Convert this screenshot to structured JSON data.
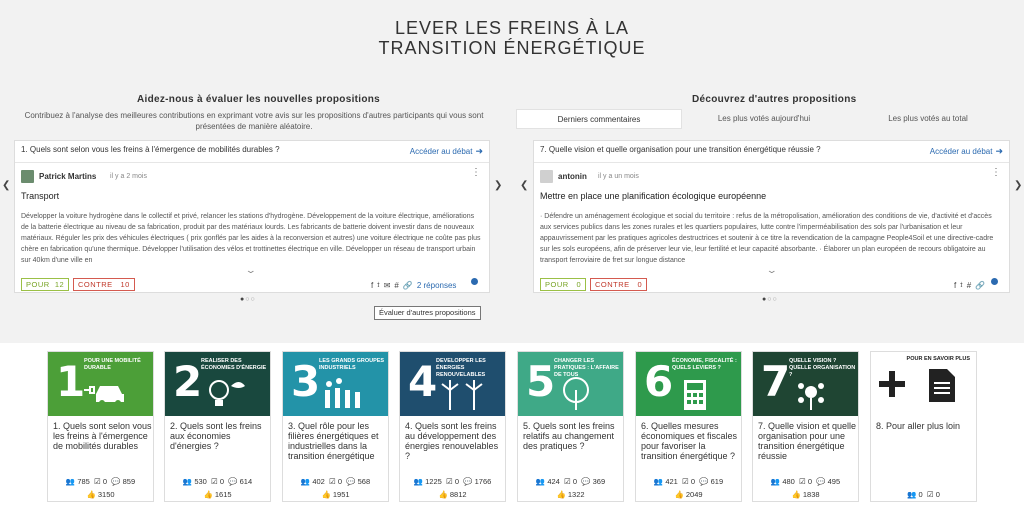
{
  "page": {
    "title_line1": "LEVER LES FREINS À LA",
    "title_line2": "TRANSITION ÉNERGÉTIQUE"
  },
  "colors": {
    "accent_blue": "#2b6ab0",
    "pour_green": "#77a324",
    "contre_red": "#c0392b"
  },
  "left_panel": {
    "heading": "Aidez-nous à évaluer les nouvelles propositions",
    "intro": "Contribuez à l'analyse des meilleures contributions en exprimant votre avis sur les propositions d'autres participants qui vous sont présentées de manière aléatoire.",
    "card": {
      "question": "1. Quels sont selon vous les freins à l'émergence de mobilités durables ?",
      "debate_link": "Accéder au débat",
      "author": "Patrick Martins",
      "time": "il y a 2 mois",
      "title": "Transport",
      "body": "Développer la voiture hydrogène dans le collectif et privé, relancer les stations d'hydrogène. Développement de la voiture électrique, améliorations de la batterie électrique au niveau de sa fabrication, produit par des matériaux lourds. Les fabricants de batterie doivent investir dans de nouveaux matériaux. Réguler les prix des véhicules électriques ( prix gonflés par les aides à la reconversion et autres) une voiture électrique ne coûte pas plus chère en fabrication qu'une thermique. Développer l'utilisation des vélos et trottinettes électrique en ville. Développer un réseau de transport urbain sur 40km d'une ville en",
      "pour_label": "POUR",
      "pour_count": "12",
      "contre_label": "CONTRE",
      "contre_count": "10",
      "replies": "2 réponses"
    },
    "eval_button": "Évaluer d'autres propositions"
  },
  "right_panel": {
    "heading": "Découvrez d'autres propositions",
    "tabs": [
      "Derniers commentaires",
      "Les plus votés aujourd'hui",
      "Les plus votés au total"
    ],
    "card": {
      "question": "7. Quelle vision et quelle organisation pour une transition énergétique réussie ?",
      "debate_link": "Accéder au débat",
      "author": "antonin",
      "time": "il y a un mois",
      "title": "Mettre en place une planification écologique européenne",
      "body": "· Défendre un aménagement écologique et social du territoire : refus de la métropolisation, amélioration des conditions de vie, d'activité et d'accès aux services publics dans les zones rurales et les quartiers populaires, lutte contre l'imperméabilisation des sols par l'urbanisation et leur appauvrissement par les pratiques agricoles destructrices et soutenir à ce titre la revendication de la campagne People4Soil et une directive-cadre sur les sols européens, afin de préserver leur vie, leur fertilité et leur capacité absorbante. · Élaborer un plan européen de recours obligatoire au transport ferroviaire de fret sur longue distance",
      "pour_label": "POUR",
      "pour_count": "0",
      "contre_label": "CONTRE",
      "contre_count": "0"
    }
  },
  "themes": [
    {
      "num": "1",
      "caption": "POUR UNE MOBILITÉ DURABLE",
      "color": "#4c9f38",
      "icon": "car-plug-icon",
      "question": "1. Quels sont selon vous les freins à l'émergence de mobilités durables",
      "participants": "785",
      "proposals": "0",
      "comments": "859",
      "votes": "3150"
    },
    {
      "num": "2",
      "caption": "REALISER DES ÉCONOMIES D'ÉNERGIE",
      "color": "#19483e",
      "icon": "bulb-icon",
      "question": "2. Quels sont les freins aux économies d'énergies ?",
      "participants": "530",
      "proposals": "0",
      "comments": "614",
      "votes": "1615"
    },
    {
      "num": "3",
      "caption": "LES GRANDS GROUPES INDUSTRIELS",
      "color": "#2393a8",
      "icon": "factory-icon",
      "question": "3. Quel rôle pour les filières énergétiques et industrielles dans la transition énergétique",
      "participants": "402",
      "proposals": "0",
      "comments": "568",
      "votes": "1951"
    },
    {
      "num": "4",
      "caption": "DEVELOPPER LES ÉNERGIES RENOUVELABLES",
      "color": "#1f4e6e",
      "icon": "wind-turbine-icon",
      "question": "4. Quels sont les freins au développement des énergies renouvelables ?",
      "participants": "1225",
      "proposals": "0",
      "comments": "1766",
      "votes": "8812"
    },
    {
      "num": "5",
      "caption": "CHANGER LES PRATIQUES : L'AFFAIRE DE TOUS",
      "color": "#3fa987",
      "icon": "tree-icon",
      "question": "5. Quels sont les freins relatifs au changement des pratiques ?",
      "participants": "424",
      "proposals": "0",
      "comments": "369",
      "votes": "1322"
    },
    {
      "num": "6",
      "caption": "ÉCONOMIE, FISCALITÉ : QUELS LEVIERS ?",
      "color": "#2e9a4c",
      "icon": "calculator-icon",
      "question": "6. Quelles mesures économiques et fiscales pour favoriser la transition énergétique ?",
      "participants": "421",
      "proposals": "0",
      "comments": "619",
      "votes": "2049"
    },
    {
      "num": "7",
      "caption": "QUELLE VISION ? QUELLE ORGANISATION ?",
      "color": "#1f4533",
      "icon": "network-icon",
      "question": "7. Quelle vision et quelle organisation pour une transition énergétique réussie",
      "participants": "480",
      "proposals": "0",
      "comments": "495",
      "votes": "1838"
    }
  ],
  "more_card": {
    "caption": "POUR EN SAVOIR PLUS",
    "question": "8. Pour aller plus loin",
    "participants": "0",
    "proposals": "0"
  }
}
